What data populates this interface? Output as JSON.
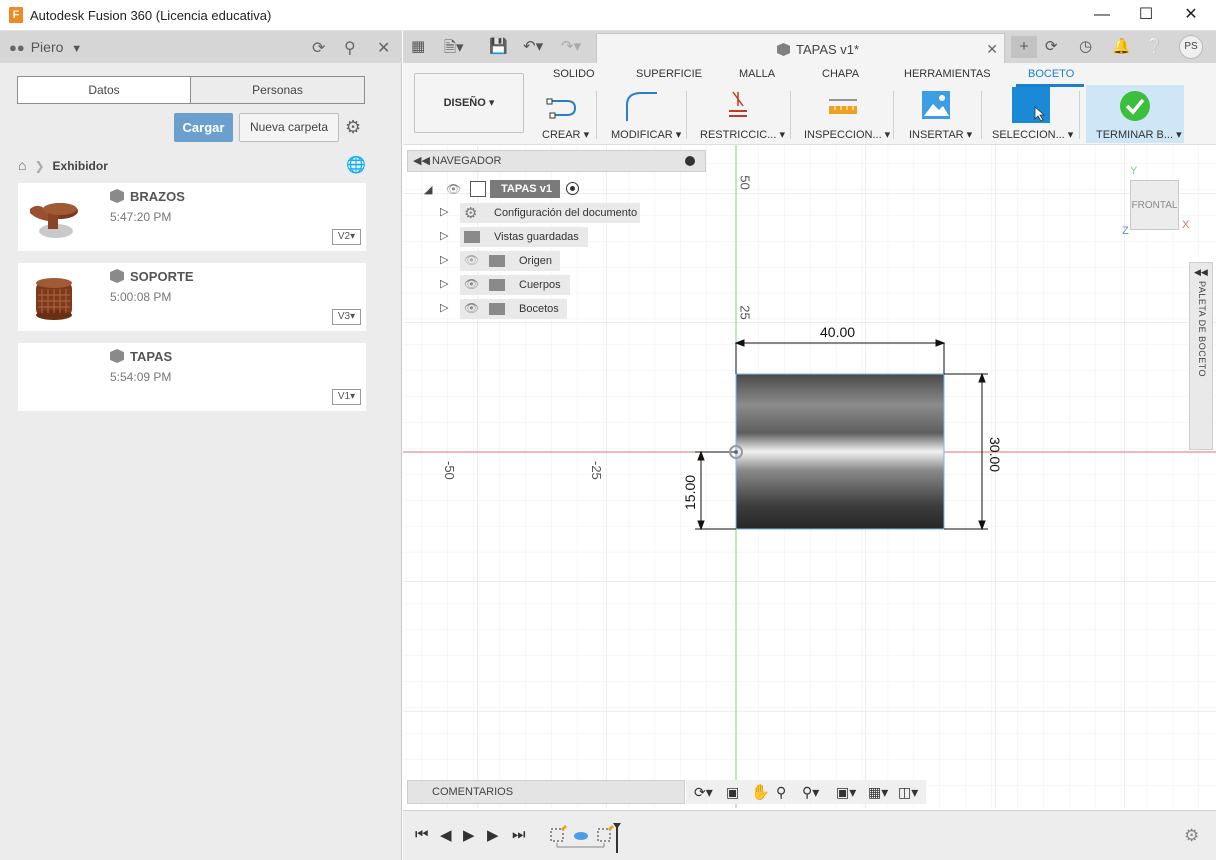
{
  "window": {
    "title": "Autodesk Fusion 360 (Licencia educativa)",
    "logo_letter": "F"
  },
  "leftpanel": {
    "user": "Piero",
    "tabs": [
      "Datos",
      "Personas"
    ],
    "upload_label": "Cargar",
    "new_folder_label": "Nueva carpeta",
    "breadcrumb": "Exhibidor",
    "files": [
      {
        "name": "BRAZOS",
        "time": "5:47:20 PM",
        "version": "V2"
      },
      {
        "name": "SOPORTE",
        "time": "5:00:08 PM",
        "version": "V3"
      },
      {
        "name": "TAPAS",
        "time": "5:54:09 PM",
        "version": "V1"
      }
    ]
  },
  "tabbar": {
    "doc_tab": "TAPAS v1*",
    "avatar": "PS"
  },
  "toolbar": {
    "workspace": "DISEÑO",
    "tabs": [
      "SOLIDO",
      "SUPERFICIE",
      "MALLA",
      "CHAPA",
      "HERRAMIENTAS",
      "BOCETO"
    ],
    "tools": [
      "CREAR",
      "MODIFICAR",
      "RESTRICCIC...",
      "INSPECCION...",
      "INSERTAR",
      "SELECCION...",
      "TERMINAR B..."
    ]
  },
  "navigator": {
    "title": "NAVEGADOR",
    "root": "TAPAS v1",
    "items": [
      "Configuración del documento",
      "Vistas guardadas",
      "Origen",
      "Cuerpos",
      "Bocetos"
    ]
  },
  "canvas": {
    "axis_labels": {
      "v50": "50",
      "v25": "25",
      "h_neg50": "-50",
      "h_neg25": "-25"
    },
    "dimensions": {
      "width": "40.00",
      "height": "30.00",
      "offset": "15.00"
    },
    "view_cube": "FRONTAL",
    "axis_y": "Y",
    "axis_x": "X",
    "axis_z": "Z"
  },
  "palette": {
    "title": "PALETA DE BOCETO"
  },
  "comments": {
    "label": "COMENTARIOS"
  },
  "colors": {
    "accent": "#1a7fd0",
    "upload": "#6a9fce",
    "finish_green": "#3cbf3c",
    "axis_red": "#e07070",
    "axis_green": "#7fd27f"
  }
}
